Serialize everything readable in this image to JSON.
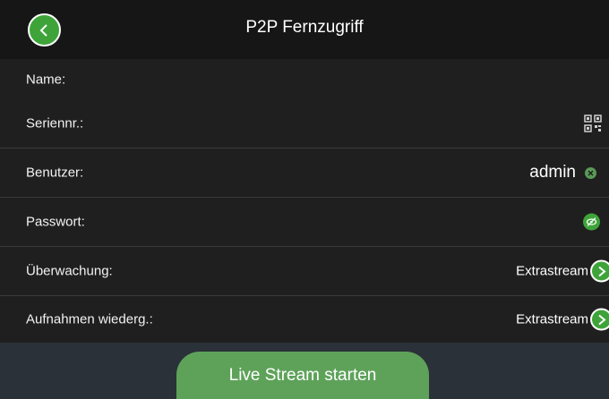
{
  "header": {
    "title": "P2P Fernzugriff"
  },
  "rows": {
    "name": {
      "label": "Name:"
    },
    "serial": {
      "label": "Seriennr.:"
    },
    "user": {
      "label": "Benutzer:",
      "value": "admin"
    },
    "password": {
      "label": "Passwort:"
    },
    "monitoring": {
      "label": "Überwachung:",
      "value": "Extrastream"
    },
    "playback": {
      "label": "Aufnahmen wiederg.:",
      "value": "Extrastream"
    }
  },
  "footer": {
    "button_label": "Live Stream starten"
  },
  "colors": {
    "accent": "#3ea43a",
    "button": "#5ea25a",
    "background": "#1f1f1f",
    "footer": "#2b3138"
  },
  "icons": [
    "back-icon",
    "qr-code-icon",
    "clear-icon",
    "eye-icon",
    "chevron-right-icon"
  ]
}
